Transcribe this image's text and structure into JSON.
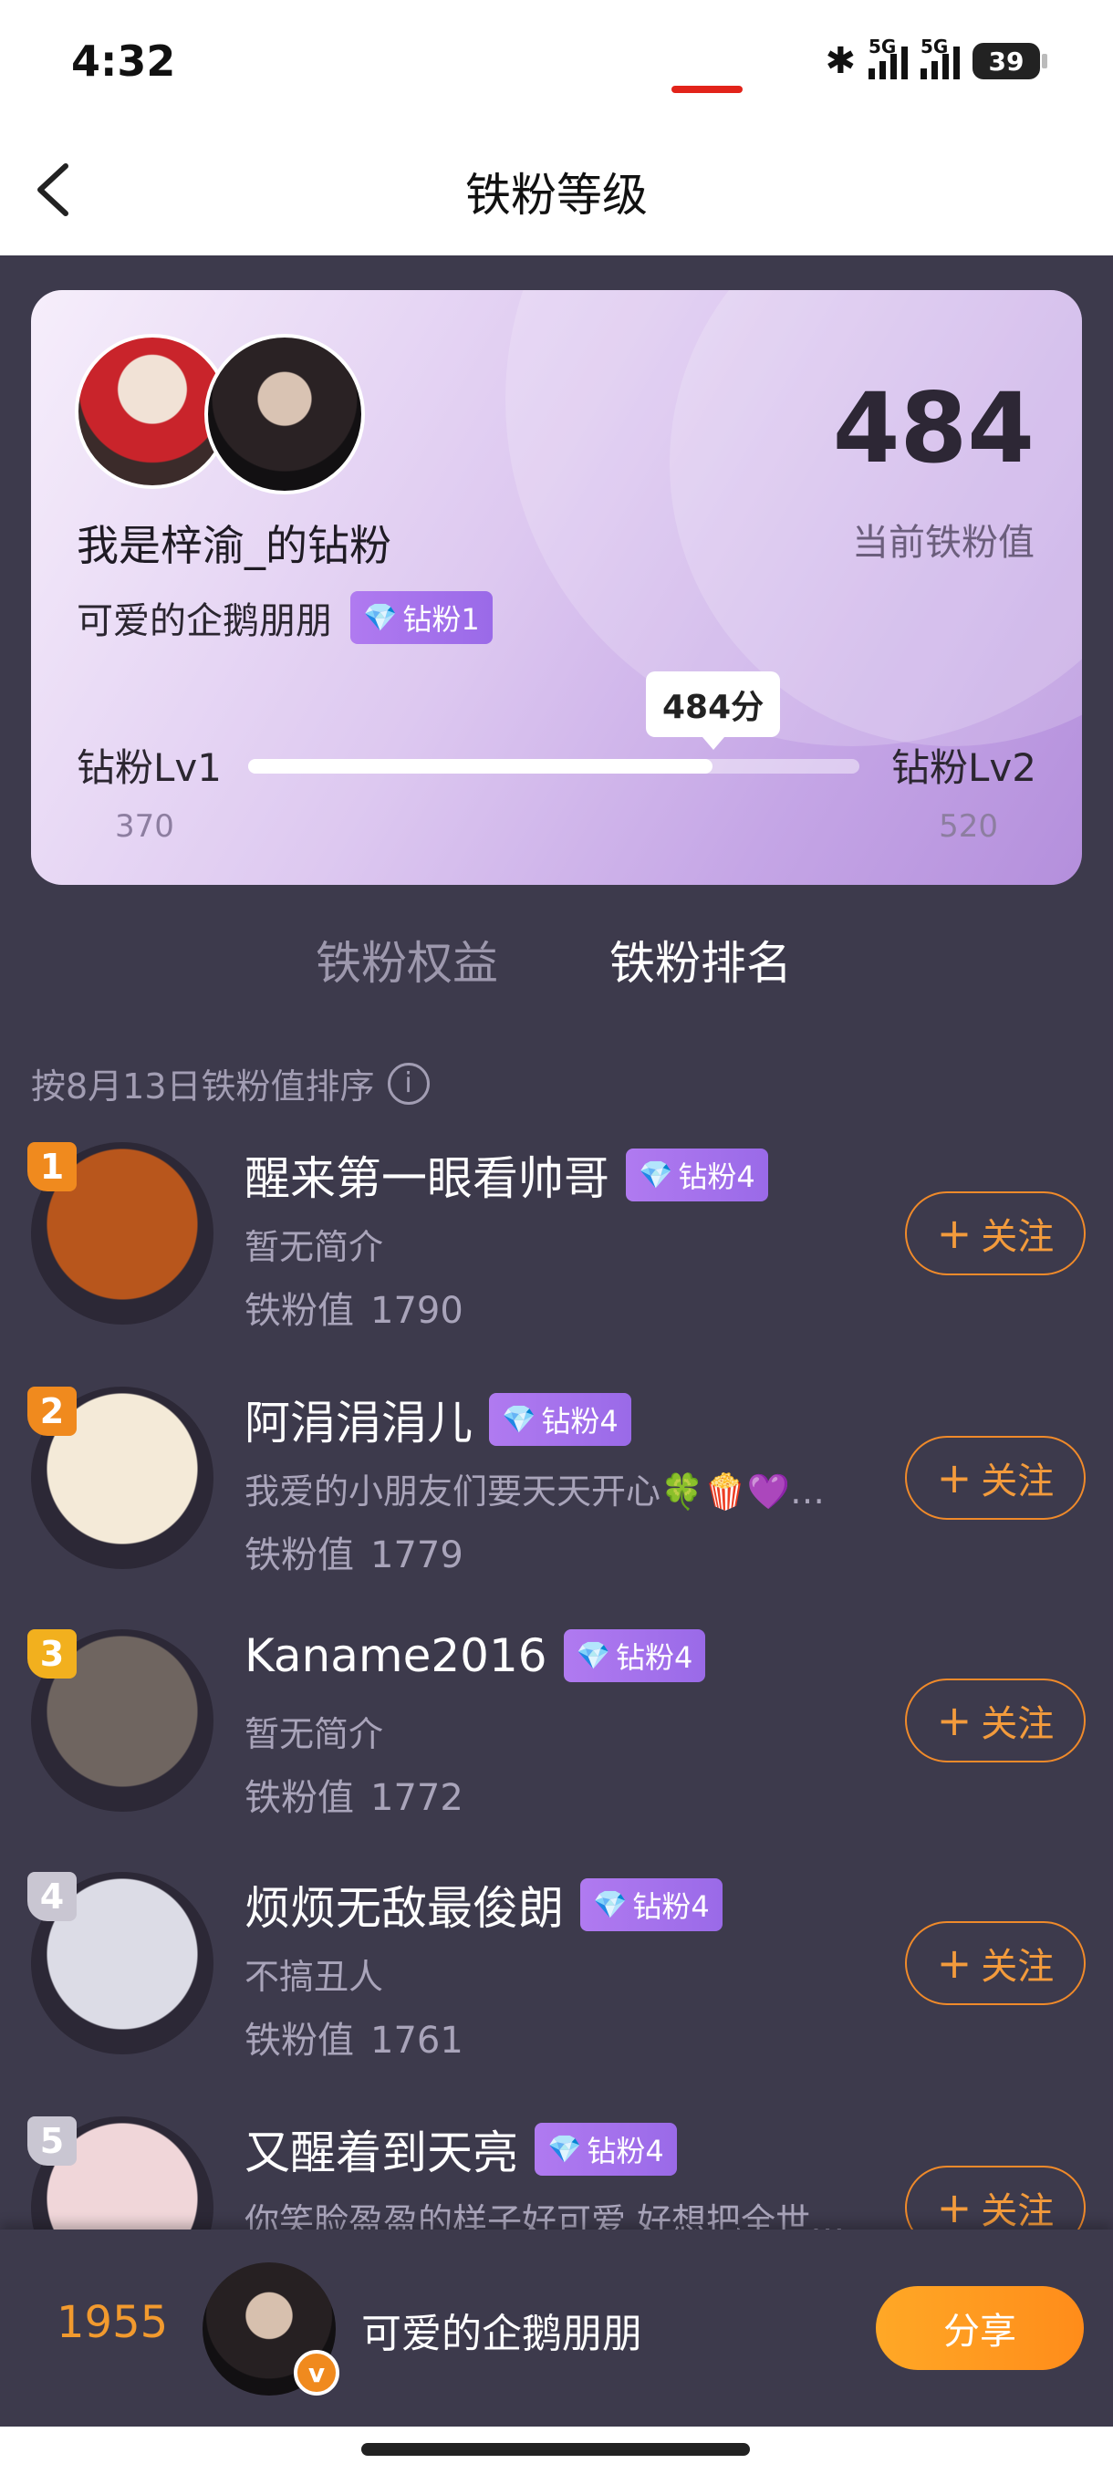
{
  "status_bar": {
    "time": "4:32",
    "battery": "39",
    "signal1_label": "5G",
    "signal2_label": "5G"
  },
  "nav": {
    "title": "铁粉等级"
  },
  "card": {
    "group_name": "我是梓渝_的钻粉",
    "user_name": "可爱的企鹅朋朋",
    "badge_label": "钻粉1",
    "score": "484",
    "score_label": "当前铁粉值",
    "level_left": "钻粉Lv1",
    "level_left_value": "370",
    "level_right": "钻粉Lv2",
    "level_right_value": "520",
    "progress_label": "484分",
    "progress_fraction": 0.76
  },
  "tabs": [
    {
      "label": "铁粉权益",
      "active": false
    },
    {
      "label": "铁粉排名",
      "active": true
    }
  ],
  "sort_note": "按8月13日铁粉值排序",
  "score_prefix": "铁粉值",
  "follow_label": "关注",
  "ranking": [
    {
      "rank": "1",
      "name": "醒来第一眼看帅哥",
      "badge": "钻粉4",
      "bio": "暂无简介",
      "score": "1790",
      "rank_color": "#f08a1e",
      "avatar_color": "#b8561c"
    },
    {
      "rank": "2",
      "name": "阿涓涓涓儿",
      "badge": "钻粉4",
      "bio": "我爱的小朋友们要天天开心🍀🍿💜…",
      "score": "1779",
      "rank_color": "#f08a1e",
      "avatar_color": "#f4ead8"
    },
    {
      "rank": "3",
      "name": "Kaname2016",
      "badge": "钻粉4",
      "bio": "暂无简介",
      "score": "1772",
      "rank_color": "#f2b01e",
      "avatar_color": "#6f6560"
    },
    {
      "rank": "4",
      "name": "烦烦无敌最俊朗",
      "badge": "钻粉4",
      "bio": "不搞丑人",
      "score": "1761",
      "rank_color": "#c9c6d2",
      "avatar_color": "#dcdce6"
    },
    {
      "rank": "5",
      "name": "又醒着到天亮",
      "badge": "钻粉4",
      "bio": "你笑脸盈盈的样子好可爱 好想把全世…",
      "score": "",
      "rank_color": "#c9c6d2",
      "avatar_color": "#f0d6d9"
    }
  ],
  "bottom_bar": {
    "my_rank": "1955",
    "my_name": "可爱的企鹅朋朋",
    "verified_mark": "v",
    "share_label": "分享"
  }
}
